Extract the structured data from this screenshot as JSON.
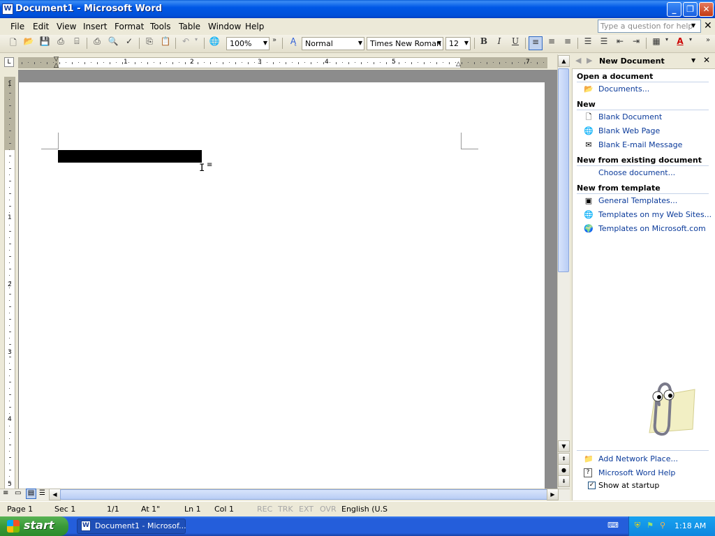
{
  "window": {
    "title": "Document1 - Microsoft Word",
    "app_icon": "W"
  },
  "window_controls": {
    "minimize": "_",
    "maximize": "❐",
    "close": "✕"
  },
  "menu": {
    "items": [
      "File",
      "Edit",
      "View",
      "Insert",
      "Format",
      "Tools",
      "Table",
      "Window",
      "Help"
    ],
    "help_placeholder": "Type a question for help",
    "doc_close": "✕"
  },
  "toolbar": {
    "zoom": "100%",
    "style": "Normal",
    "font": "Times New Roman",
    "size": "12",
    "bold": "B",
    "italic": "I",
    "underline": "U",
    "font_color_glyph": "A"
  },
  "ruler": {
    "marks": [
      "1",
      "2",
      "3",
      "4",
      "5",
      "7"
    ],
    "corner": "L"
  },
  "vruler": {
    "marks": [
      "1",
      "1",
      "2",
      "3",
      "4",
      "5"
    ]
  },
  "task_pane": {
    "title": "New Document",
    "sections": {
      "open": {
        "heading": "Open a document",
        "links": [
          "Documents..."
        ]
      },
      "new": {
        "heading": "New",
        "links": [
          "Blank Document",
          "Blank Web Page",
          "Blank E-mail Message"
        ]
      },
      "existing": {
        "heading": "New from existing document",
        "links": [
          "Choose document..."
        ]
      },
      "template": {
        "heading": "New from template",
        "links": [
          "General Templates...",
          "Templates on my Web Sites...",
          "Templates on Microsoft.com"
        ]
      }
    },
    "bottom_links": [
      "Add Network Place...",
      "Microsoft Word Help"
    ],
    "show_at_startup": "Show at startup",
    "show_at_startup_checked": true
  },
  "status": {
    "page": "Page 1",
    "sec": "Sec 1",
    "pages": "1/1",
    "at": "At 1\"",
    "ln": "Ln 1",
    "col": "Col 1",
    "rec": "REC",
    "trk": "TRK",
    "ext": "EXT",
    "ovr": "OVR",
    "language": "English (U.S"
  },
  "taskbar": {
    "start": "start",
    "task_label": "Document1 - Microsof...",
    "clock": "1:18 AM"
  }
}
